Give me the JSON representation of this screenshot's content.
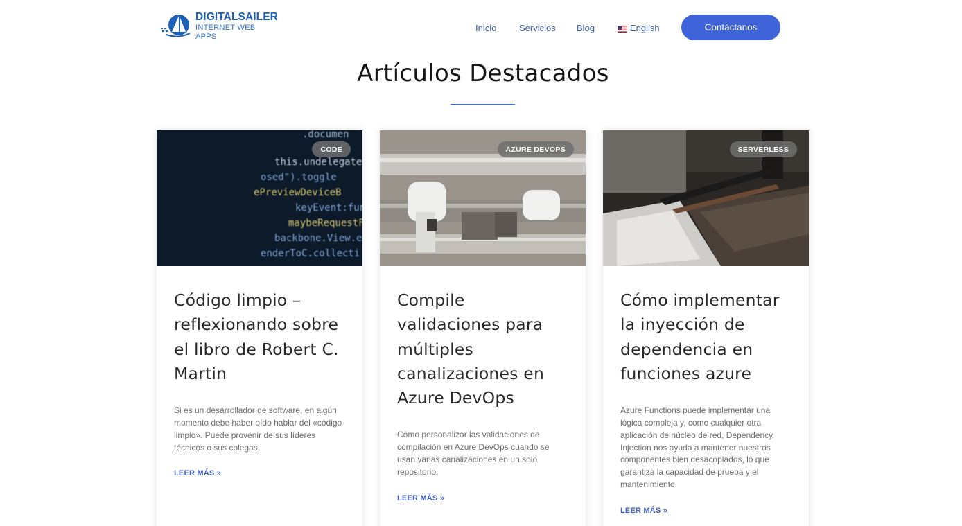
{
  "brand": {
    "title": "DIGITALSAILER",
    "subtitle": "INTERNET WEB APPS"
  },
  "nav": {
    "items": [
      "Inicio",
      "Servicios",
      "Blog"
    ],
    "language": "English"
  },
  "cta": {
    "label": "Contáctanos"
  },
  "section": {
    "title": "Artículos Destacados"
  },
  "colors": {
    "accent": "#3f63d8",
    "link": "#3b5ea8",
    "badge": "#6e6e6e"
  },
  "cards": [
    {
      "badge": "CODE",
      "title": "Código limpio – reflexionando sobre el libro de Robert C. Martin",
      "excerpt": "Si es un desarrollador de software, en algún momento debe haber oído hablar del «código limpio». Puede provenir de sus líderes técnicos o sus colegas,",
      "more": "LEER MÁS »"
    },
    {
      "badge": "AZURE DEVOPS",
      "title": "Compile validaciones para múltiples canalizaciones en Azure DevOps",
      "excerpt": "Cómo personalizar las validaciones de compilación en Azure DevOps cuando se usan varias canalizaciones en un solo repositorio.",
      "more": "LEER MÁS »"
    },
    {
      "badge": "SERVERLESS",
      "title": "Cómo implementar la inyección de dependencia en funciones azure",
      "excerpt": "Azure Functions puede implementar una lógica compleja y, como cualquier otra aplicación de núcleo de red, Dependency Injection nos ayuda a mantener nuestros componentes bien desacoplados, lo que garantiza la capacidad de prueba y el mantenimiento.",
      "more": "LEER MÁS »"
    }
  ]
}
